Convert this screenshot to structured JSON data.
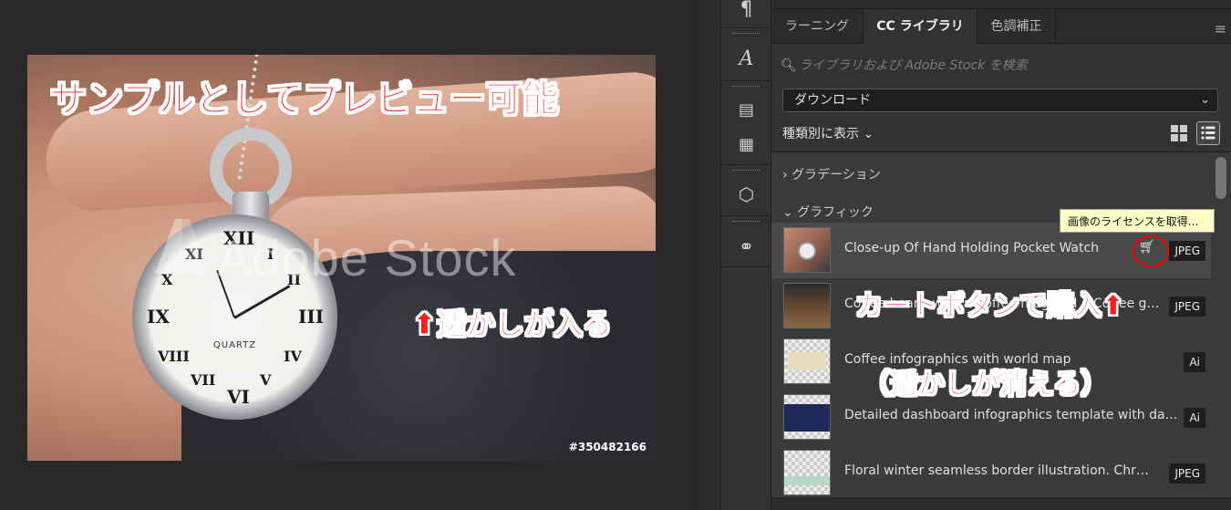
{
  "canvas": {
    "annotation_top": "サンプルとしてプレビュー可能",
    "annotation_watermark": "⬆透かしが入る",
    "watermark_text": "Adobe Stock",
    "stock_id": "#350482166",
    "watch_label": "QUARTZ"
  },
  "panel": {
    "tabs": [
      {
        "label": "ラーニング"
      },
      {
        "label": "CC ライブラリ",
        "active": true
      },
      {
        "label": "色調補正"
      }
    ],
    "search": {
      "placeholder": "ライブラリおよび Adobe Stock を検索"
    },
    "dropdown": {
      "selected": "ダウンロード"
    },
    "view_by": "種類別に表示",
    "sections": [
      {
        "label": "グラデーション",
        "expanded": false
      },
      {
        "label": "グラフィック",
        "expanded": true
      }
    ],
    "items": [
      {
        "title": "Close-up Of Hand Holding Pocket Watch",
        "badge": "JPEG"
      },
      {
        "title": "Coffee beans with a Coffee mug and a Coffee grinder on wooden table",
        "badge": "JPEG"
      },
      {
        "title": "Coffee infographics with world map",
        "badge": "Ai"
      },
      {
        "title": "Detailed dashboard infographics template with data visualization",
        "badge": "Ai"
      },
      {
        "title": "Floral winter seamless border illustration. Christmas",
        "badge": "JPEG"
      }
    ],
    "tooltip": "画像のライセンスを取得...",
    "annotation_cart": "カートボタンで購入⬆",
    "annotation_disappear": "（透かしが消える）"
  },
  "colors": {
    "annotation_red": "#ff1f1f",
    "panel_bg": "#323232",
    "tooltip_bg": "#ffffc8"
  }
}
